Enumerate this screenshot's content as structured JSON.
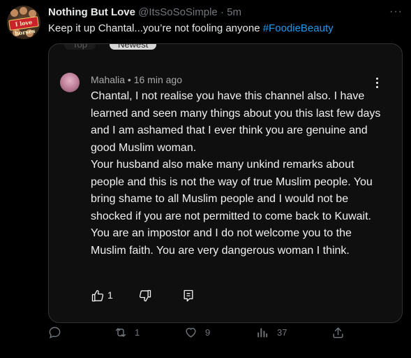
{
  "tweet": {
    "author_name": "Nothing But Love",
    "handle": "@ItsSoSoSimple",
    "separator": "·",
    "time": "5m",
    "text": "Keep it up Chantal...you’re not fooling anyone ",
    "hashtag": "#FoodieBeauty",
    "avatar_sign": "I love horses"
  },
  "embedded_comment": {
    "tabs": [
      "Top",
      "Newest"
    ],
    "selected_tab": "Newest",
    "author": "Mahalia",
    "time": "16 min ago",
    "meta": "Mahalia • 16 min ago",
    "paragraph_1": "Chantal, I not realise you have this channel also. I have learned and seen many things about you this last few days and I am ashamed that I ever think you are genuine and good Muslim woman.",
    "paragraph_2": "Your husband also make many unkind remarks about people and this is not the way of true Muslim people. You bring shame to all Muslim people and I would not be shocked if you are not permitted to come back to Kuwait. You are an impostor and I do not welcome you to the Muslim faith. You are very dangerous woman I think.",
    "likes": "1"
  },
  "actions": {
    "replies": "",
    "retweets": "1",
    "likes": "9",
    "views": "37"
  },
  "icons": {
    "more": "more-horizontal-icon",
    "reply": "reply-icon",
    "retweet": "retweet-icon",
    "like": "heart-icon",
    "views": "analytics-icon",
    "share": "share-icon"
  },
  "colors": {
    "background": "#000000",
    "accent": "#1d9bf0",
    "muted": "#71767b",
    "card": "#0f0f0f"
  }
}
